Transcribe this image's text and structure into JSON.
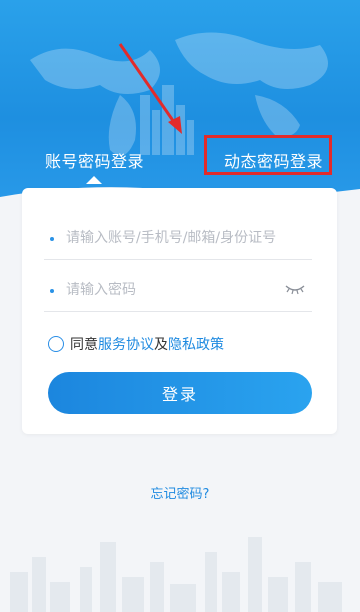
{
  "tabs": {
    "account_login": "账号密码登录",
    "dynamic_login": "动态密码登录"
  },
  "form": {
    "username_placeholder": "请输入账号/手机号/邮箱/身份证号",
    "password_placeholder": "请输入密码",
    "agree_prefix": "同意",
    "service_agreement": "服务协议",
    "agree_and": "及",
    "privacy_policy": "隐私政策",
    "login_button": "登录"
  },
  "forgot_password": "忘记密码?",
  "colors": {
    "primary": "#1f8ae0",
    "annotation": "#e22b2b"
  },
  "icons": {
    "password_visibility": "eye-closed-icon"
  }
}
